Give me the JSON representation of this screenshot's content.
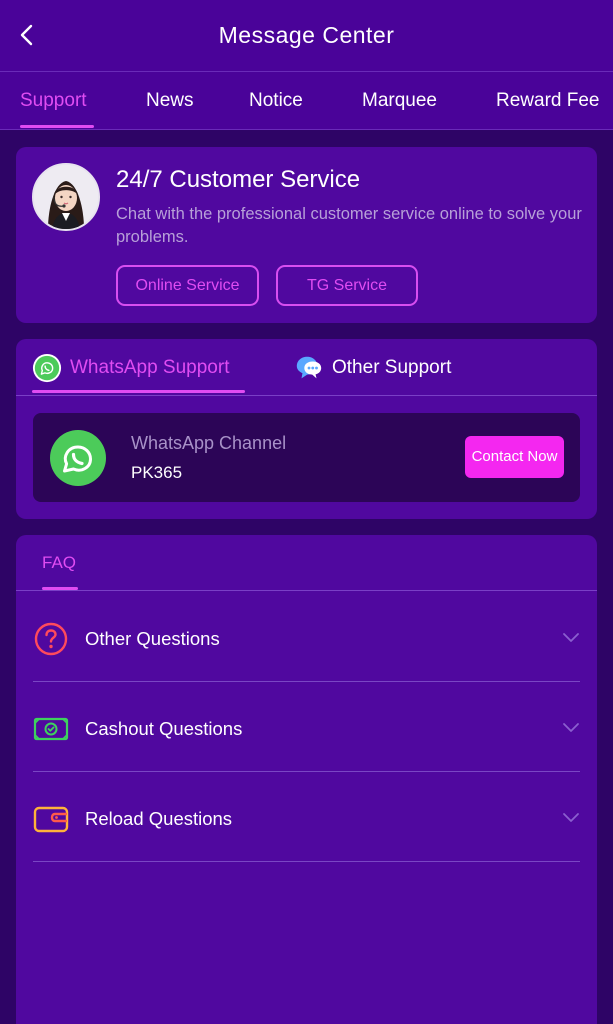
{
  "header": {
    "title": "Message Center"
  },
  "tabs": [
    {
      "label": "Support",
      "active": true
    },
    {
      "label": "News"
    },
    {
      "label": "Notice"
    },
    {
      "label": "Marquee"
    },
    {
      "label": "Reward Fee"
    }
  ],
  "customer_service": {
    "title": "24/7 Customer Service",
    "description": "Chat with the professional customer service online to solve your problems.",
    "buttons": {
      "online": "Online Service",
      "tg": "TG Service"
    }
  },
  "support": {
    "tabs": [
      {
        "label": "WhatsApp Support",
        "icon": "whatsapp-icon",
        "active": true
      },
      {
        "label": "Other Support",
        "icon": "chat-bubble-icon"
      }
    ],
    "channel": {
      "name": "WhatsApp Channel",
      "id": "PK365",
      "contact_label": "Contact Now"
    }
  },
  "faq": {
    "tab_label": "FAQ",
    "items": [
      {
        "label": "Other Questions",
        "icon": "question-circle-icon"
      },
      {
        "label": "Cashout Questions",
        "icon": "cash-bill-icon"
      },
      {
        "label": "Reload Questions",
        "icon": "wallet-icon"
      }
    ]
  },
  "colors": {
    "background": "#2e0466",
    "header": "#4a0399",
    "card": "#50089f",
    "accent": "#e04cf2",
    "button_fill": "#f427f0",
    "whatsapp_green": "#4ccb5a"
  }
}
